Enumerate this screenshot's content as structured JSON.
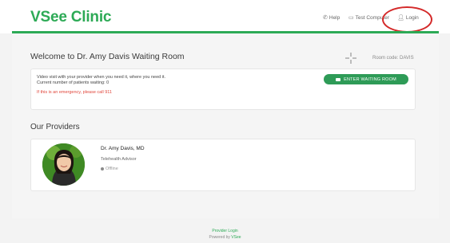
{
  "header": {
    "logo": "VSee Clinic",
    "help_label": "Help",
    "test_label": "Test Computer",
    "login_label": "Login"
  },
  "welcome": {
    "title": "Welcome to Dr. Amy Davis Waiting Room",
    "room_code": "Room code: DAVIS",
    "line1": "Video visit with your provider when you need it, where you need it.",
    "line2": "Current number of patients waiting: 0",
    "emergency": "If this is an emergency, please call 911",
    "enter_button": "ENTER WAITING ROOM"
  },
  "providers": {
    "title": "Our Providers",
    "items": [
      {
        "name": "Dr. Amy Davis, MD",
        "role": "Telehealth Advisor",
        "status": "Offline"
      }
    ]
  },
  "footer": {
    "provider_login": "Provider Login",
    "powered_by": "Powered by",
    "powered_by_brand": "VSee"
  },
  "colors": {
    "brand": "#2daa56",
    "button": "#2e9b57",
    "emergency": "#e0453a",
    "annotation_circle": "#d42a2a"
  }
}
